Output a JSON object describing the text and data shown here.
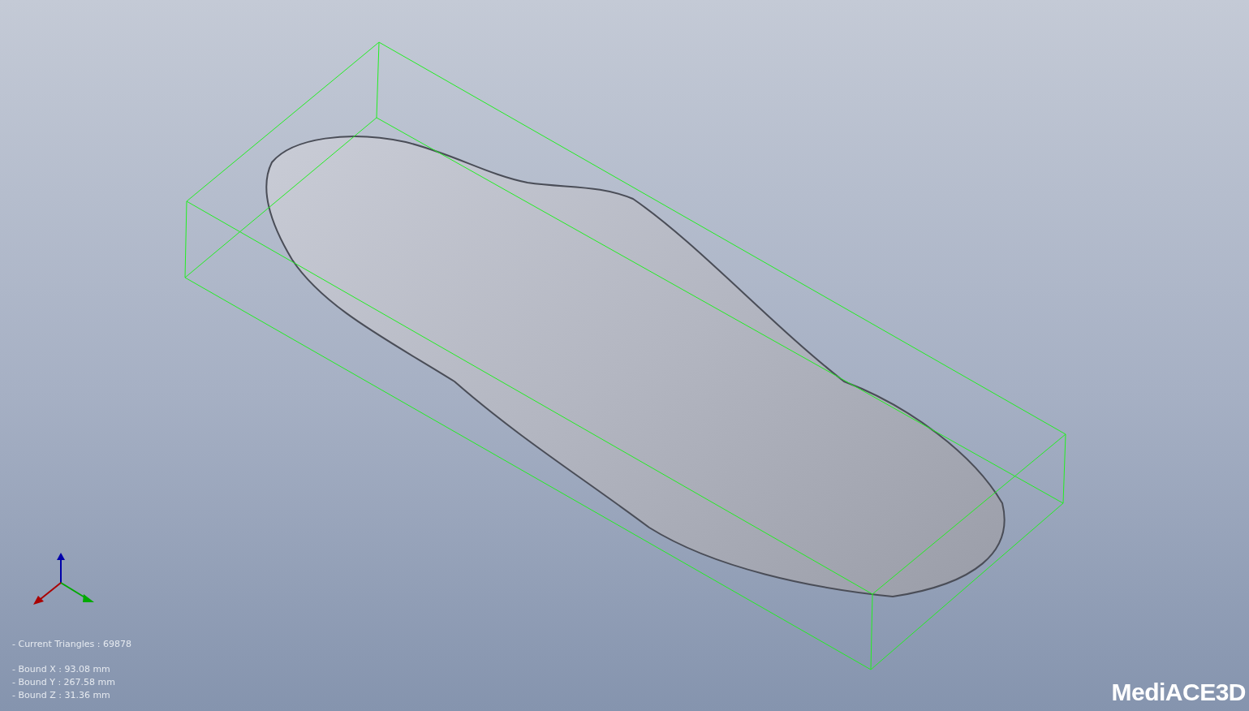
{
  "info": {
    "triangles": "- Current Triangles : 69878",
    "bounds": [
      "- Bound X : 93.08 mm",
      "- Bound Y : 267.58 mm",
      "- Bound Z : 31.36 mm"
    ]
  },
  "logo": "MediACE3D"
}
